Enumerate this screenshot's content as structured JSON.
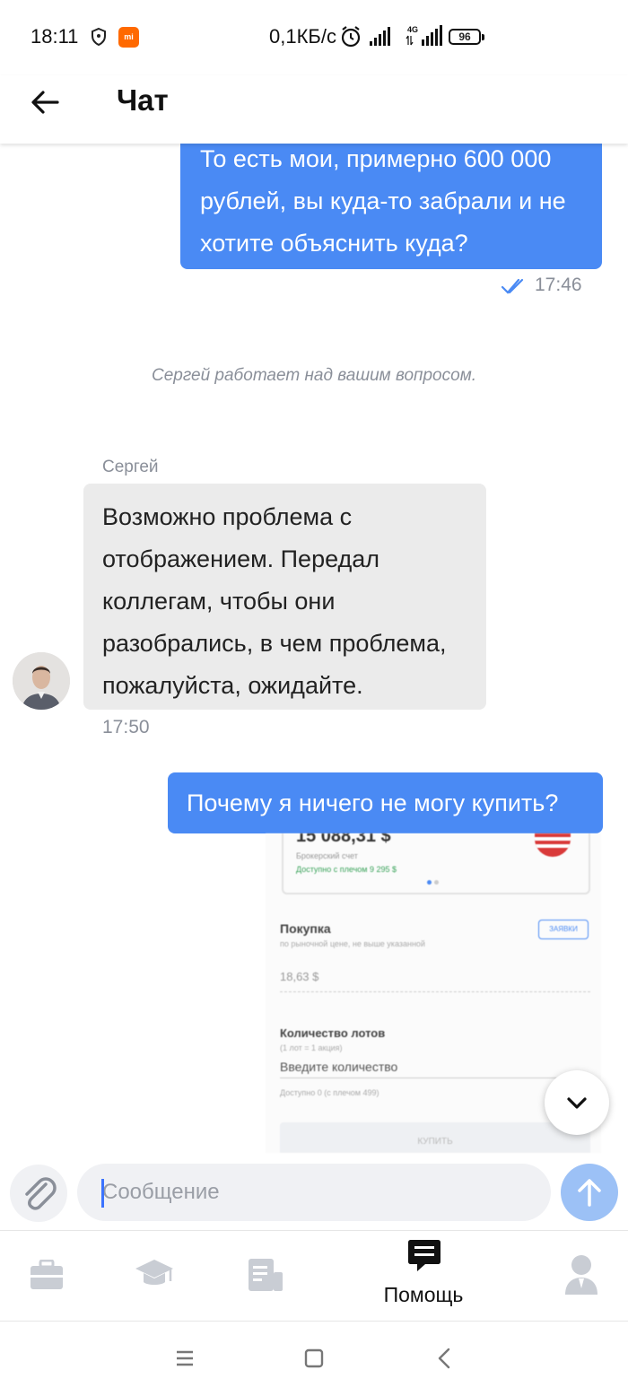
{
  "status_bar": {
    "time": "18:11",
    "speed": "0,1КБ/с",
    "network": "4G",
    "battery": "96"
  },
  "header": {
    "title": "Чат"
  },
  "messages": [
    {
      "type": "outgoing",
      "text": "То есть мои, примерно 600 000\nрублей, вы куда-то забрали и не\nхотите объяснить куда?",
      "time": "17:46",
      "status": "read"
    },
    {
      "type": "system",
      "text": "Сергей работает над вашим вопросом."
    },
    {
      "type": "incoming",
      "sender": "Сергей",
      "text": "Возможно проблема с\nотображением. Передал\nколлегам, чтобы они\nразобрались, в чем проблема,\nпожалуйста, ожидайте.",
      "time": "17:50"
    },
    {
      "type": "outgoing",
      "text": "Почему я ничего не могу купить?"
    }
  ],
  "attachment": {
    "balance": "15 088,31 $",
    "account": "Брокерский счет",
    "available": "Доступно с плечом 9 295 $",
    "purchase_title": "Покупка",
    "purchase_hint": "по рыночной цене, не выше указанной",
    "order_type": "ЗАЯВКИ",
    "price": "18,63 $",
    "lots_title": "Количество лотов",
    "lots_hint": "(1 лот = 1 акция)",
    "lots_placeholder": "Введите количество",
    "available_lots": "Доступно 0 (с плечом 499)",
    "buy_button": "КУПИТЬ"
  },
  "composer": {
    "placeholder": "Сообщение"
  },
  "bottom_nav": [
    {
      "id": "portfolio",
      "label": "",
      "icon": "briefcase-icon",
      "active": false
    },
    {
      "id": "learning",
      "label": "",
      "icon": "graduation-cap-icon",
      "active": false
    },
    {
      "id": "news",
      "label": "",
      "icon": "newspaper-icon",
      "active": false
    },
    {
      "id": "help",
      "label": "Помощь",
      "icon": "chat-bubble-icon",
      "active": true
    },
    {
      "id": "profile",
      "label": "",
      "icon": "person-icon",
      "active": false
    }
  ],
  "colors": {
    "accent": "#4a8af4",
    "send_disabled": "#9cc1f6",
    "incoming_bubble": "#ebebeb",
    "inactive_icon": "#c9cdd4"
  }
}
